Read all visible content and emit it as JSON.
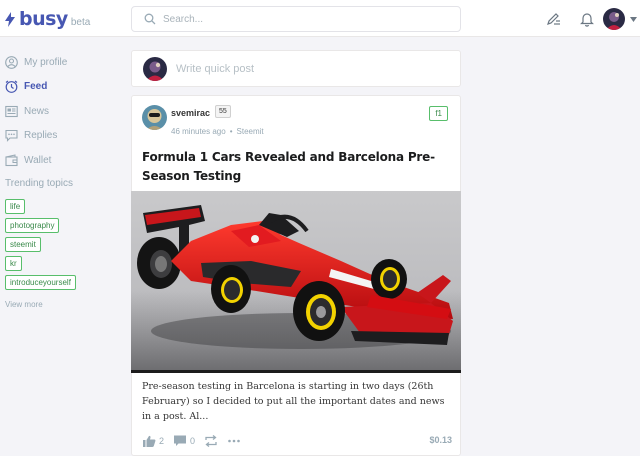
{
  "brand": {
    "name": "busy",
    "badge": "beta"
  },
  "search": {
    "placeholder": "Search..."
  },
  "nav": [
    {
      "label": "My profile",
      "icon": "user-icon",
      "active": false
    },
    {
      "label": "Feed",
      "icon": "clock-icon",
      "active": true
    },
    {
      "label": "News",
      "icon": "news-icon",
      "active": false
    },
    {
      "label": "Replies",
      "icon": "chat-icon",
      "active": false
    },
    {
      "label": "Wallet",
      "icon": "wallet-icon",
      "active": false
    }
  ],
  "trending": {
    "title": "Trending topics",
    "tags": [
      "life",
      "photography",
      "steemit",
      "kr",
      "introduceyourself"
    ],
    "view_more": "View more"
  },
  "quickpost": {
    "placeholder": "Write quick post"
  },
  "story": {
    "author": "svemirac",
    "reputation": "55",
    "time": "46 minutes ago",
    "app": "Steemit",
    "topic": "f1",
    "title": "Formula 1 Cars Revealed and Barcelona Pre-Season Testing",
    "body": "Pre-season testing in Barcelona is starting in two days (26th February) so I decided to put all the important dates and news in a post. Al...",
    "likes": "2",
    "comments": "0",
    "payout": "$0.13",
    "image_subject": "red Ferrari Formula 1 car on grey studio background"
  },
  "colors": {
    "brand": "#4757b2",
    "tag_border": "#58be6b",
    "muted": "#99aab5",
    "background": "#f4f4f8",
    "car_red": "#d40d12"
  }
}
